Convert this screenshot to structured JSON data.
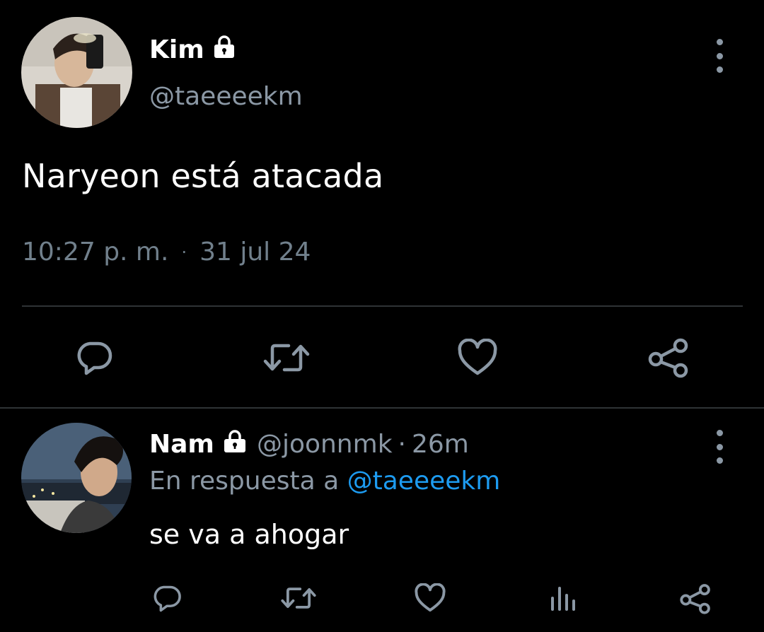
{
  "main_tweet": {
    "author_name": "Kim",
    "author_handle": "@taeeeekm",
    "text": "Naryeon está atacada",
    "time": "10:27 p. m.",
    "separator": "·",
    "date": "31 jul 24"
  },
  "reply": {
    "author_name": "Nam",
    "author_handle": "@joonnmk",
    "separator": "·",
    "time": "26m",
    "reply_prefix": "En respuesta a",
    "reply_to": "@taeeeekm",
    "text": "se va a ahogar"
  },
  "icons": {
    "lock": "lock-icon",
    "more": "more-vertical-icon",
    "reply": "comment-icon",
    "retweet": "retweet-icon",
    "like": "heart-icon",
    "share": "share-icon",
    "analytics": "analytics-icon"
  },
  "colors": {
    "background": "#000000",
    "text": "#ffffff",
    "secondary": "#8b98a5",
    "accent": "#1d9bf0",
    "divider": "#2f3336"
  }
}
